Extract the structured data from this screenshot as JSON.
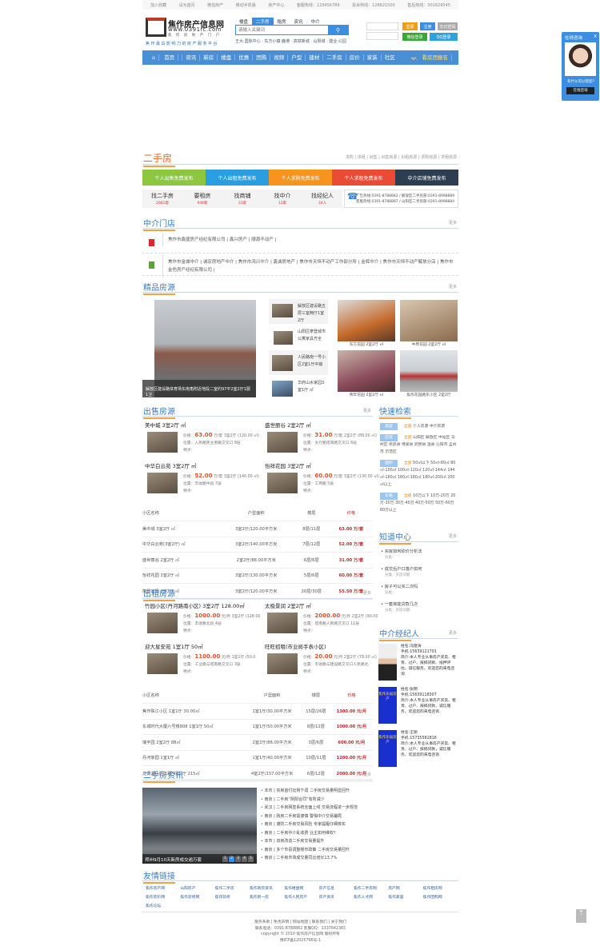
{
  "topbar": {
    "links": [
      "加入收藏",
      "设为首页",
      "微信房产",
      "移动手机版",
      "房产中心"
    ],
    "hotlines": [
      "客服热线：123456789",
      "投诉热线：128821500",
      "售后热线：301629545"
    ]
  },
  "logo": {
    "title": "焦作房产信息网",
    "url": "www.0391fc.com",
    "sub": "焦 作 房 地 产 门 户",
    "slogan": "焦作最具影响力的房产服务平台"
  },
  "search": {
    "tabs": [
      "楼盘",
      "二手房",
      "租房",
      "资讯",
      "中介"
    ],
    "active": 1,
    "placeholder": "请输入关键词",
    "hot": "王大·国际中心 · 东方小镇·鹿港 · 高铁新城 · 山阳城 · 建业·公园"
  },
  "login": {
    "user_placeholder": "",
    "pass_placeholder": "",
    "login": "登录",
    "register": "注册",
    "forgot": "忘记密码",
    "wechat": "微信登录",
    "qq": "QQ登录"
  },
  "nav": {
    "items": [
      "首页",
      "资讯",
      "新房",
      "楼盘",
      "优惠",
      "团购",
      "视频",
      "户型",
      "建材",
      "二手房",
      "房价",
      "家装",
      "社区"
    ],
    "right": "看房团报名"
  },
  "esf": {
    "title": "二手房",
    "sub": "求购 | 求租 | 出售 | 出售房源 | 出租房源 | 求购房源 | 求租房源",
    "publish": [
      {
        "label": "个人出售免费发布",
        "color": "#8dc63f"
      },
      {
        "label": "个人出租免费发布",
        "color": "#2a9ee0"
      },
      {
        "label": "个人求购免费发布",
        "color": "#f7941d"
      },
      {
        "label": "个人求租免费发布",
        "color": "#e94b35"
      },
      {
        "label": "中介店铺免费发布",
        "color": "#2c3e50"
      }
    ],
    "finds": [
      {
        "label": "找二手房",
        "count": "2081套"
      },
      {
        "label": "要租房",
        "count": "948套"
      },
      {
        "label": "找商铺",
        "count": "33套"
      },
      {
        "label": "找中介",
        "count": "12家"
      },
      {
        "label": "找经纪人",
        "count": "34人"
      }
    ],
    "contact": [
      "广告热线:0391-8788882 / 解放区二手房部:0391-8998889",
      "客服热线:0391-8788887 / 山阳区二手房部:0391-8998884"
    ]
  },
  "agencies": {
    "title": "中介门店",
    "more": "更多",
    "row1": "焦作市鑫盛房产经纪有限公司 | 鑫兴房产 | 顺源不动产 |",
    "row2": "焦作市金城中介 | 诚宏房地产中介 | 焦作市鸿兴中介 | 鑫诚房地产 | 焦作市天恒不动产工作部分所 | 金辉中介 | 焦作市天恒不动产解放分店 | 焦作市金色房产经纪有限公司 |"
  },
  "featured": {
    "title": "精品房源",
    "more": "更多",
    "main_caption": "解放区建设路体育场东南角附近地段二室约97平2室2厅1厨1卫",
    "list": [
      "解放区建设路五层三室两厅1室2厅",
      "山阳区摩登城市公寓家具齐全",
      "人民路南一号小区2室1厅中装",
      "华府山水家园3室1厅 ㎡"
    ],
    "photos": [
      "东方花园 2室2厅 ㎡",
      "中原花园 2室2厅 ㎡",
      "青年花园 2室2厅 ㎡",
      "焦作花园路东小区 2室2厅"
    ]
  },
  "sale": {
    "title": "出售房源",
    "more": "更多",
    "items": [
      {
        "title": "美中城 3室2厅 ㎡",
        "price": "63.00",
        "unit": "万/套 3室2厅 (120.00 ㎡)",
        "loc": "位置：人民路民主南路交叉口 8层",
        "feat": "特点："
      },
      {
        "title": "盛世丽谷 2室2厅 ㎡",
        "price": "31.00",
        "unit": "万/套 2室2厅 (88.00 ㎡)",
        "loc": "位置：太行路塔南路交叉口 6层",
        "feat": "特点："
      },
      {
        "title": "中华白云苑 3室2厅 ㎡",
        "price": "52.00",
        "unit": "万/套 3室2厅 (140.00 ㎡)",
        "loc": "位置：丰收路中段 7层",
        "feat": "特点："
      },
      {
        "title": "怡祥花园 3室2厅 ㎡",
        "price": "60.00",
        "unit": "万/套 3室2厅 (130.00 ㎡)",
        "loc": "位置：工商路 5层",
        "feat": "特点："
      }
    ],
    "price_label": "价格：",
    "headers": [
      "小区名称",
      "户型面积",
      "楼层",
      "价格"
    ],
    "rows": [
      [
        "美中城 3室2厅 ㎡",
        "3室2厅/120.00平方米",
        "8层/11层",
        "63.00 万/套"
      ],
      [
        "中华白云苑(3室2厅) ㎡",
        "3室2厅/140.00平方米",
        "7层/12层",
        "52.00 万/套"
      ],
      [
        "盛世丽谷 2室2厅 ㎡",
        "2室2厅/88.00平方米",
        "6层/6层",
        "31.00 万/套"
      ],
      [
        "怡祥花园 3室2厅 ㎡",
        "3室2厅/130.00平方米",
        "5层/6层",
        "60.00 万/套"
      ],
      [
        "丽景家园 3室2厅 ㎡",
        "3室2厅/120.00平方米",
        "20层/30层",
        "55.50 万/套"
      ]
    ]
  },
  "rent": {
    "title": "出租房源",
    "more": "更多",
    "items": [
      {
        "title": "竹园小区(丹河路南小区) 3室2厅 128.00㎡",
        "price": "1000.00",
        "unit": "元/月 3室2厅 (128.00",
        "loc": "位置：丰收路北段 4层",
        "feat": "特点："
      },
      {
        "title": "太极景润 2室2厅 ㎡",
        "price": "2000.00",
        "unit": "元/月 2室2厅 (90.00",
        "loc": "位置：塔南路人民路交叉口 11层",
        "feat": "特点："
      },
      {
        "title": "迎大星安苑 1室1厅 50㎡",
        "price": "1100.00",
        "unit": "元/月 1室1厅 (50.0",
        "loc": "位置：工业路与塔南路交叉口 3层",
        "feat": "特点："
      },
      {
        "title": "旺旺招租(市业局手表小区)",
        "price": "20.00",
        "unit": "元/月 2室2厅 (78.00 ㎡)",
        "loc": "位置：丰收路与建设路交叉口人民路北",
        "feat": "特点："
      }
    ],
    "price_label": "价格：",
    "headers": [
      "小区名称",
      "户型面积",
      "楼层",
      "价格"
    ],
    "rows": [
      [
        "焦作珠江小区 1室1厅 30.00㎡",
        "1室1厅/30.00平方米",
        "15层/26层",
        "1300.00 元/月"
      ],
      [
        "东城时代大厦六号楼808 1室1厅 50㎡",
        "1室1厅/50.00平方米",
        "8层/12层",
        "1000.00 元/月"
      ],
      [
        "瑞丰园 2室2厅 88㎡",
        "2室2厅/88.00平方米",
        "3层/6层",
        "600.00 元/月"
      ],
      [
        "丹河家园 1室1厅 ㎡",
        "1室1厅/40.00平方米",
        "10层/11层",
        "1200.00 元/月"
      ],
      [
        "龙源湖小区二期 4室2厅 215㎡",
        "4室2厅/157.00平方米",
        "6层/12层",
        "2000.00 元/月"
      ]
    ]
  },
  "quick": {
    "title": "快速检索",
    "groups": [
      {
        "tag": "类型",
        "all": "全部",
        "opts": "个人房源 中介房源"
      },
      {
        "tag": "区域",
        "all": "全部",
        "opts": "山阳区 解放区 中站区 马村区 修武县 博爱县 武陟县 温县 沁阳市 孟州市 示范区"
      },
      {
        "tag": "面积",
        "all": "全部",
        "opts": "50㎡以下 50㎡-80㎡ 80㎡-100㎡ 100㎡-120㎡ 120㎡-144㎡ 144㎡-160㎡ 160㎡-180㎡ 180㎡-200㎡ 200㎡以上"
      },
      {
        "tag": "价格",
        "all": "全部",
        "opts": "10万以下 10万-20万 20万-30万 30万-40万 40万-50万 50万-60万 60万以上"
      }
    ]
  },
  "know": {
    "title": "知道中心",
    "more": "更多",
    "items": [
      {
        "q": "买房如何砍价分析法",
        "c": "分类："
      },
      {
        "q": "成交后户口落户如何",
        "c": "分类：买房问题"
      },
      {
        "q": "房子可以买二次吗",
        "c": "分类："
      },
      {
        "q": "一套房能贷款几次",
        "c": "分类：买房问题"
      }
    ]
  },
  "agents": {
    "title": "中介经纪人",
    "more": "更多",
    "items": [
      {
        "name": "姓名:冯建涛",
        "phone": "手机:15639121701",
        "bio": "简介:本人专业从事房产买卖、租赁、过户、按揭贷款、抵押评估，诚信服务，欢迎您的来电咨询"
      },
      {
        "name": "姓名:张明",
        "phone": "手机:15639118307",
        "bio": "简介:本人专业从事房产买卖、租赁、过户、按揭贷款，诚信服务，欢迎您的来电咨询"
      },
      {
        "name": "姓名:王丽",
        "phone": "手机:15735582816",
        "bio": "简介:本人专业从事房产买卖、租赁、过户、按揭贷款，诚信服务，欢迎您的来电咨询"
      }
    ],
    "ad_text": "焦作乐居房产"
  },
  "news": {
    "title": "二手房资讯",
    "more": "更多",
    "caption": "郑州9月10天新房成交逾万套",
    "pages": [
      "1",
      "2",
      "3",
      "4",
      "5"
    ],
    "items": [
      "本市 | 买房首付比例下调 二手房交易量明显回升",
      "南京 | 二手房“阴阳合同”有所减少",
      "武汉 | 二手房网签系统全面上线 交易流程进一步规范",
      "南京 | 购房二手房需谨慎 警惕中介交易骗局",
      "南京 | 谨防二手房交易风险 专家提醒仔细核实",
      "南京 | 二手房中介乱收费 业主如何维权？",
      "本市 | 旧房改造二手房交易量提升",
      "南京 | 多个市县调整楼市政策 二手房交易量回升",
      "南京 | 二手房市场成交量同比增长13.7%"
    ]
  },
  "links": {
    "title": "友情链接",
    "items": [
      "焦作房产网",
      "山阳房产",
      "焦作二手房",
      "焦作新房资讯",
      "焦作楼盘网",
      "房产信息",
      "焦作二手房网",
      "房产网",
      "焦作租房网",
      "焦作房价网",
      "焦作装修网",
      "焦作装修",
      "焦作新一房",
      "焦作人民房产",
      "房产资讯",
      "焦作人才网",
      "焦作家居",
      "焦作团购网",
      "焦作论坛"
    ]
  },
  "footer": [
    "服务条款 | 免责声明 | 网站地图 | 联系我们 | 关于我们",
    "联系电话：0391-8788882 客服QQ：1337642365",
    "copyright © 2010 焦作房产信息网 版权所有",
    "豫ICP备12025796号-1"
  ],
  "float": {
    "title": "在线咨询",
    "close": "X",
    "text": "有什么可以帮您?",
    "button": "在线咨询"
  }
}
